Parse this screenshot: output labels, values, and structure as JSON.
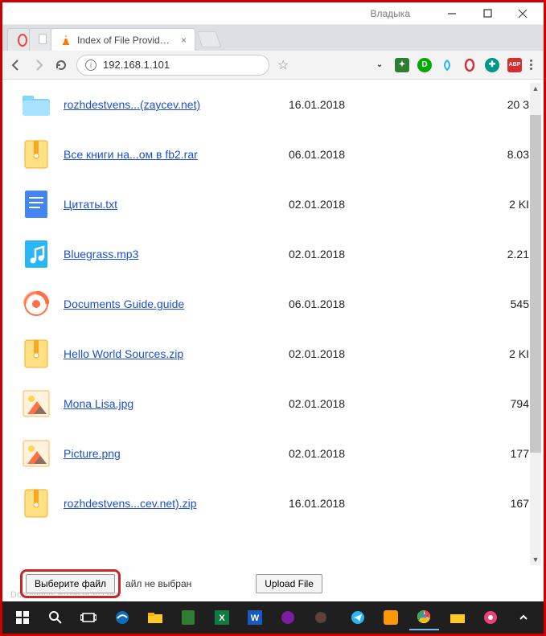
{
  "window": {
    "user_label": "Владыка"
  },
  "tabs": {
    "active_title": "Index of File Provider St…"
  },
  "address": {
    "url": "192.168.1.101"
  },
  "files": [
    {
      "name": "rozhdestvens...(zaycev.net)",
      "date": "16.01.2018",
      "size": "20 3",
      "icon": "folder"
    },
    {
      "name": "Все книги на...ом в fb2.rar",
      "date": "06.01.2018",
      "size": "8.03",
      "icon": "zip"
    },
    {
      "name": "Цитаты.txt",
      "date": "02.01.2018",
      "size": "2 KI",
      "icon": "txt"
    },
    {
      "name": "Bluegrass.mp3",
      "date": "02.01.2018",
      "size": "2.21",
      "icon": "mp3"
    },
    {
      "name": "Documents Guide.guide",
      "date": "06.01.2018",
      "size": "545",
      "icon": "guide"
    },
    {
      "name": "Hello World Sources.zip",
      "date": "02.01.2018",
      "size": "2 KI",
      "icon": "zip"
    },
    {
      "name": "Mona Lisa.jpg",
      "date": "02.01.2018",
      "size": "794",
      "icon": "img"
    },
    {
      "name": "Picture.png",
      "date": "02.01.2018",
      "size": "177",
      "icon": "img"
    },
    {
      "name": "rozhdestvens...cev.net).zip",
      "date": "16.01.2018",
      "size": "167",
      "icon": "zip"
    }
  ],
  "footer": {
    "choose_label": "Выберите файл",
    "nofile_label": "айл не выбран",
    "upload_label": "Upload File",
    "faded_text": "Documents Browser Access"
  }
}
